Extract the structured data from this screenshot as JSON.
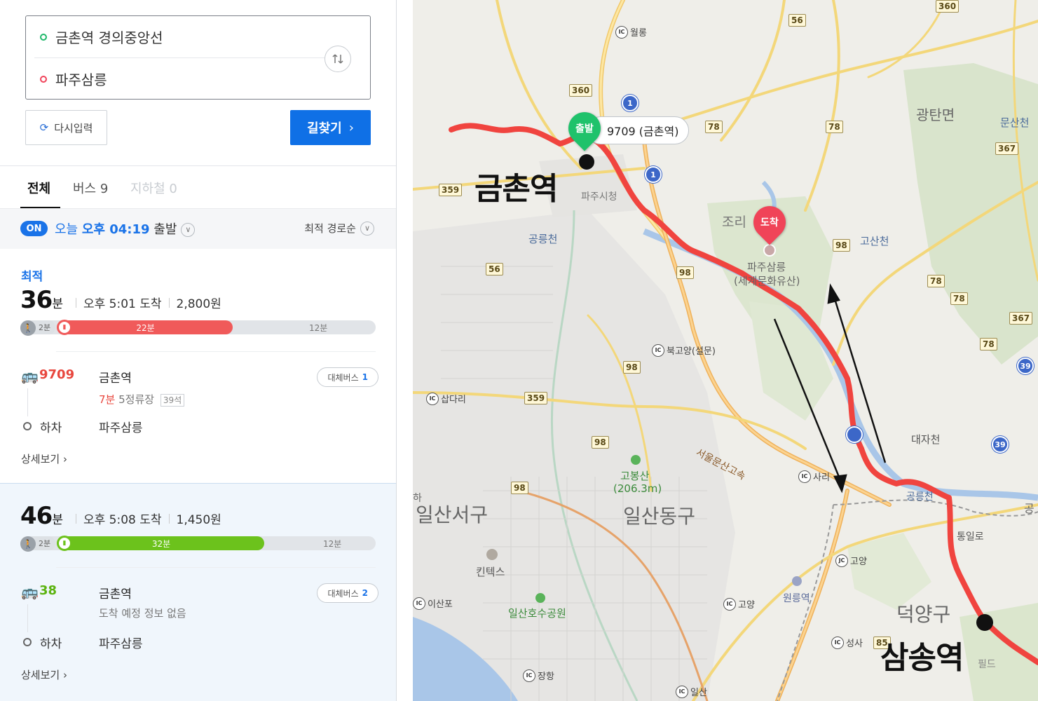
{
  "search": {
    "origin": "금촌역 경의중앙선",
    "destination": "파주삼릉",
    "reset_label": "다시입력",
    "search_label": "길찾기"
  },
  "tabs": [
    {
      "label": "전체",
      "active": true
    },
    {
      "label": "버스 9",
      "active": false
    },
    {
      "label": "지하철 0",
      "active": false,
      "disabled": true
    }
  ],
  "filter": {
    "on_badge": "ON",
    "today": "오늘",
    "time": "오후 04:19",
    "depart_suffix": "출발",
    "sort": "최적 경로순"
  },
  "routes": [
    {
      "best_label": "최적",
      "minutes": "36",
      "unit": "분",
      "arrival": "오후 5:01 도착",
      "fare": "2,800원",
      "walk": "2분",
      "ride": "22분",
      "rest": "12분",
      "ride_fraction": 0.55,
      "color": "#f05a5a",
      "bus_number": "9709",
      "board_stop": "금촌역",
      "wait": "7분",
      "stops_left": "5정류장",
      "seats": "39석",
      "alt_bus_label": "대체버스",
      "alt_bus_count": "1",
      "alight_label": "하차",
      "alight_stop": "파주삼릉",
      "detail_label": "상세보기"
    },
    {
      "best_label": "",
      "minutes": "46",
      "unit": "분",
      "arrival": "오후 5:08 도착",
      "fare": "1,450원",
      "walk": "2분",
      "ride": "32분",
      "rest": "12분",
      "ride_fraction": 0.65,
      "color": "#6cc21c",
      "bus_number": "38",
      "board_stop": "금촌역",
      "no_info": "도착 예정 정보 없음",
      "alt_bus_label": "대체버스",
      "alt_bus_count": "2",
      "alight_label": "하차",
      "alight_stop": "파주삼릉",
      "detail_label": "상세보기"
    }
  ],
  "map": {
    "start_marker": "출발",
    "end_marker": "도착",
    "tooltip": "9709 (금촌역)",
    "station_start": "금촌역",
    "station_end": "삼송역",
    "places": {
      "gwangtan": "광탄면",
      "munsan": "문산천",
      "jori": "조리",
      "gosancheon": "고산천",
      "gongneungcheon": "공릉천",
      "paju_samneung": "파주삼릉",
      "heritage": "(세계문화유산)",
      "paju_city": "파주시청",
      "daejacheon": "대자천",
      "gobongsan": "고봉산",
      "gobong_height": "(206.3m)",
      "ilsandong": "일산동구",
      "ilsanseo": "일산서구",
      "deogyang": "덕양구",
      "kintex": "킨텍스",
      "ilsan_lake": "일산호수공원",
      "wondang": "원릉역",
      "seoul_ring": "서울문산고속",
      "tongil": "통일로",
      "gongneung2": "공릉천",
      "pild": "필드",
      "ha": "하",
      "gong": "공"
    },
    "ics": {
      "wolnong": "월롱",
      "bukgoyang": "북고양(설문)",
      "sapdari": "삽다리",
      "sari": "사리",
      "goyang_jc": "고양",
      "goyang_ic": "고양",
      "seongsa": "성사",
      "ilsan": "일산",
      "janghang": "장항",
      "isanpo": "이산포"
    },
    "ic_badge": "IC",
    "jc_badge": "JC",
    "roads": {
      "r360a": "360",
      "r56a": "56",
      "r360b": "360",
      "r78a": "78",
      "r78b": "78",
      "r367a": "367",
      "r359a": "359",
      "r98a": "98",
      "r98b": "98",
      "r56b": "56",
      "r78c": "78",
      "r78d": "78",
      "r367b": "367",
      "r78e": "78",
      "r98c": "98",
      "r359b": "359",
      "r98d": "98",
      "r98e": "98",
      "r85": "85"
    },
    "shields": {
      "s1a": "1",
      "s1b": "1",
      "s39a": "39",
      "s39b": "39"
    }
  }
}
